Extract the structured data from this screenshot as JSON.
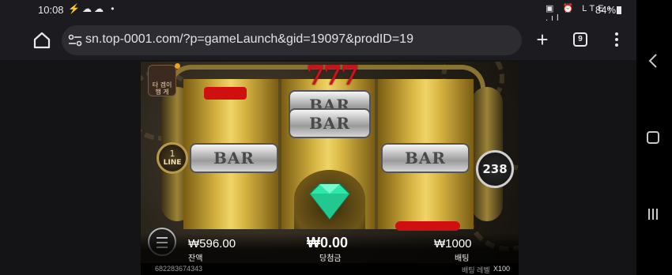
{
  "status_bar": {
    "time": "10:08",
    "notification_icons": "⚡☁☁ •",
    "system_icons": "▣ ⏰ LTE+ .ıl",
    "battery": "84%"
  },
  "browser": {
    "url": "sn.top-0001.com/?p=gameLaunch&gid=19097&prodID=19",
    "tab_count": "9",
    "new_tab_label": "+"
  },
  "game": {
    "logo_text": [
      "타 겜이",
      "행 게"
    ],
    "line_number": "1",
    "line_label": "LINE",
    "spin_count": "238",
    "sevens": "777",
    "bar_symbol": "BAR",
    "balance_value": "₩596.00",
    "balance_label": "잔액",
    "win_value": "₩0.00",
    "win_label": "당첨금",
    "bet_value": "₩1000",
    "bet_label": "배팅",
    "session_id": "682283674343",
    "bet_multiplier_label": "배팅 레벨",
    "bet_multiplier": "X100"
  },
  "colors": {
    "reel_gold": "#f0d468",
    "seven_red": "#c8141e",
    "diamond": "#2ee8a8"
  }
}
